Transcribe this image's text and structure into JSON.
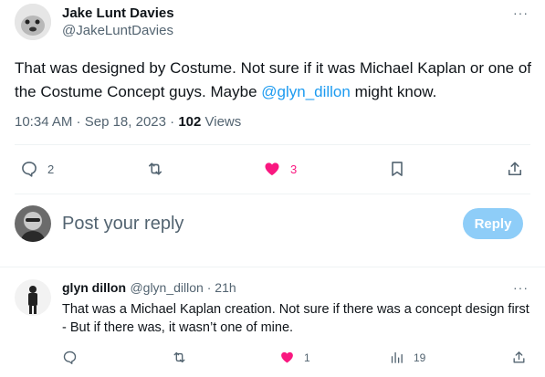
{
  "tweet": {
    "author_name": "Jake Lunt Davies",
    "author_handle": "@JakeLuntDavies",
    "more": "···",
    "text_before": "That was designed by Costume. Not sure if it was Michael Kaplan or one of the Costume Concept guys. Maybe ",
    "mention": "@glyn_dillon",
    "text_after": " might know.",
    "time": "10:34 AM",
    "sep1": " · ",
    "date": "Sep 18, 2023",
    "sep2": " · ",
    "views_count": "102",
    "views_label": " Views",
    "actions": {
      "reply_count": "2",
      "like_count": "3"
    }
  },
  "compose": {
    "placeholder": "Post your reply",
    "button": "Reply"
  },
  "reply": {
    "author_name": "glyn dillon",
    "author_handle": "@glyn_dillon",
    "sep": " · ",
    "age": "21h",
    "more": "···",
    "text": "That was a Michael Kaplan creation. Not sure if there was a concept design first - But if there was, it wasn’t one of mine.",
    "actions": {
      "like_count": "1",
      "views_count": "19"
    }
  },
  "colors": {
    "accent": "#1d9bf0",
    "like": "#f91880",
    "muted": "#536471",
    "reply_button": "#8ecdf8"
  }
}
